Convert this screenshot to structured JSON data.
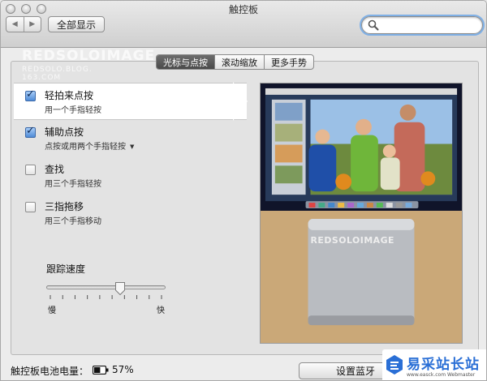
{
  "window": {
    "title": "触控板"
  },
  "toolbar": {
    "back_glyph": "◀",
    "forward_glyph": "▶",
    "show_all_label": "全部显示",
    "search_value": "",
    "search_placeholder": ""
  },
  "watermark": {
    "main": "REDSOLOIMAGE",
    "sub1": "REDSOLO.BLOG.",
    "sub2": "163.COM"
  },
  "tabs": [
    {
      "label": "光标与点按",
      "active": true
    },
    {
      "label": "滚动缩放",
      "active": false
    },
    {
      "label": "更多手势",
      "active": false
    }
  ],
  "options": [
    {
      "title": "轻拍来点按",
      "subtitle": "用一个手指轻按",
      "checked": true,
      "selected": true
    },
    {
      "title": "辅助点按",
      "subtitle": "点按或用两个手指轻按",
      "checked": true,
      "has_menu": true
    },
    {
      "title": "查找",
      "subtitle": "用三个手指轻按",
      "checked": false
    },
    {
      "title": "三指拖移",
      "subtitle": "用三个手指移动",
      "checked": false
    }
  ],
  "tracking": {
    "label": "跟踪速度",
    "slow_label": "慢",
    "fast_label": "快",
    "level": 0.62,
    "tick_count": 10
  },
  "preview": {
    "watermark": "REDSOLOIMAGE"
  },
  "footer": {
    "battery_label": "触控板电池电量：",
    "battery_percent": "57%",
    "battery_level": 0.57,
    "bluetooth_button": "设置蓝牙"
  },
  "site_logo": {
    "text": "易采站长站",
    "sub": "www.easck.com Webmaster"
  },
  "colors": {
    "accent_blue": "#4f8bd6",
    "tab_active": "#5a5a5a",
    "window_bg": "#ececec"
  }
}
